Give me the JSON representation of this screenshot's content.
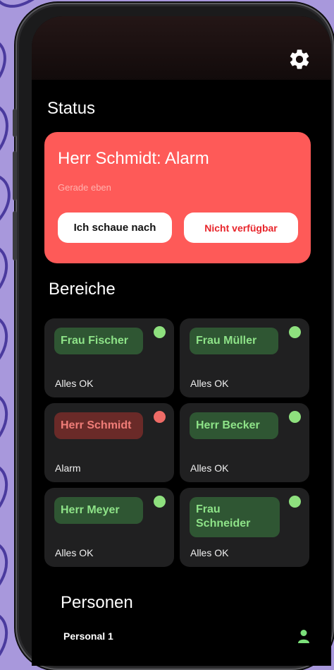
{
  "header": {
    "settings_icon": "gear-icon"
  },
  "status_section": {
    "title": "Status",
    "alarm": {
      "title": "Herr Schmidt: Alarm",
      "time": "Gerade eben",
      "primary_action": "Ich schaue nach",
      "secondary_action": "Nicht verfügbar",
      "color": "#fe5a58"
    }
  },
  "areas_section": {
    "title": "Bereiche",
    "tiles": [
      {
        "name": "Frau Fischer",
        "status": "Alles OK",
        "state": "ok"
      },
      {
        "name": "Frau Müller",
        "status": "Alles OK",
        "state": "ok"
      },
      {
        "name": "Herr Schmidt",
        "status": "Alarm",
        "state": "alarm"
      },
      {
        "name": "Herr Becker",
        "status": "Alles OK",
        "state": "ok"
      },
      {
        "name": "Herr Meyer",
        "status": "Alles OK",
        "state": "ok"
      },
      {
        "name": "Frau Schneider",
        "status": "Alles OK",
        "state": "ok"
      }
    ]
  },
  "persons_section": {
    "title": "Personen",
    "items": [
      {
        "name": "Personal 1",
        "icon": "person-icon"
      }
    ]
  },
  "colors": {
    "ok": "#8ee07e",
    "alarm": "#ee6b66",
    "background": "#000000"
  }
}
